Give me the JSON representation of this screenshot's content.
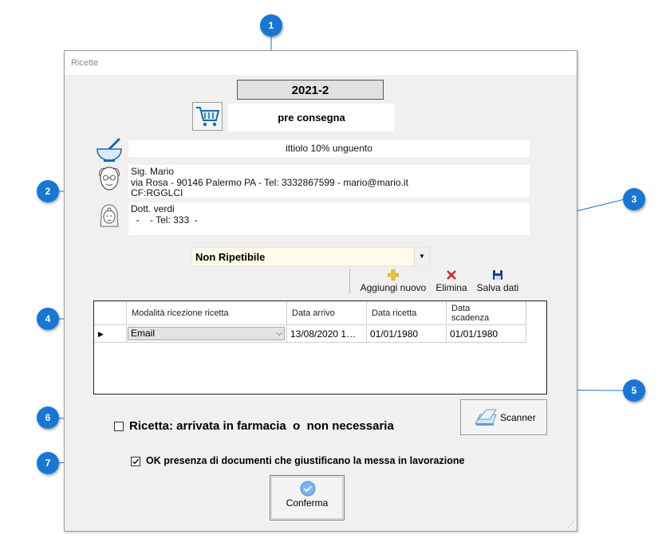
{
  "window": {
    "title": "Ricette"
  },
  "header": {
    "year": "2021-2",
    "status": "pre consegna"
  },
  "medicine": {
    "name": "ittiolo 10% unguento"
  },
  "patient": {
    "line1": "Sig. Mario",
    "line2": "via Rosa - 90146 Palermo PA - Tel:  3332867599 - mario@mario.it",
    "line3": "CF:RGGLCI"
  },
  "doctor": {
    "line1": "Dott. verdi",
    "line2": "  -    - Tel: 333  -"
  },
  "prescription_type": {
    "selected": "Non Ripetibile"
  },
  "toolbar": {
    "add_label": "Aggiungi nuovo",
    "delete_label": "Elimina",
    "save_label": "Salva dati"
  },
  "grid": {
    "columns": [
      "Modalità ricezione ricetta",
      "Data arrivo",
      "Data ricetta",
      "Data\nscadenza"
    ],
    "rows": [
      {
        "mode": "Email",
        "arrival": "13/08/2020 1…",
        "prescription_date": "01/01/1980",
        "expiry": "01/01/1980"
      }
    ]
  },
  "scanner": {
    "label": "Scanner"
  },
  "checks": {
    "arrived": {
      "label": "Ricetta: arrivata in farmacia  o  non necessaria",
      "checked": false
    },
    "documents": {
      "label": "OK presenza di documenti che giustificano la messa in lavorazione",
      "checked": true
    }
  },
  "confirm": {
    "label": "Conferma"
  },
  "callouts": [
    "1",
    "2",
    "3",
    "4",
    "5",
    "6",
    "7"
  ],
  "colors": {
    "callout": "#1877d4",
    "combo_bg": "#fffbea",
    "window_bg": "#f0f0f0"
  }
}
